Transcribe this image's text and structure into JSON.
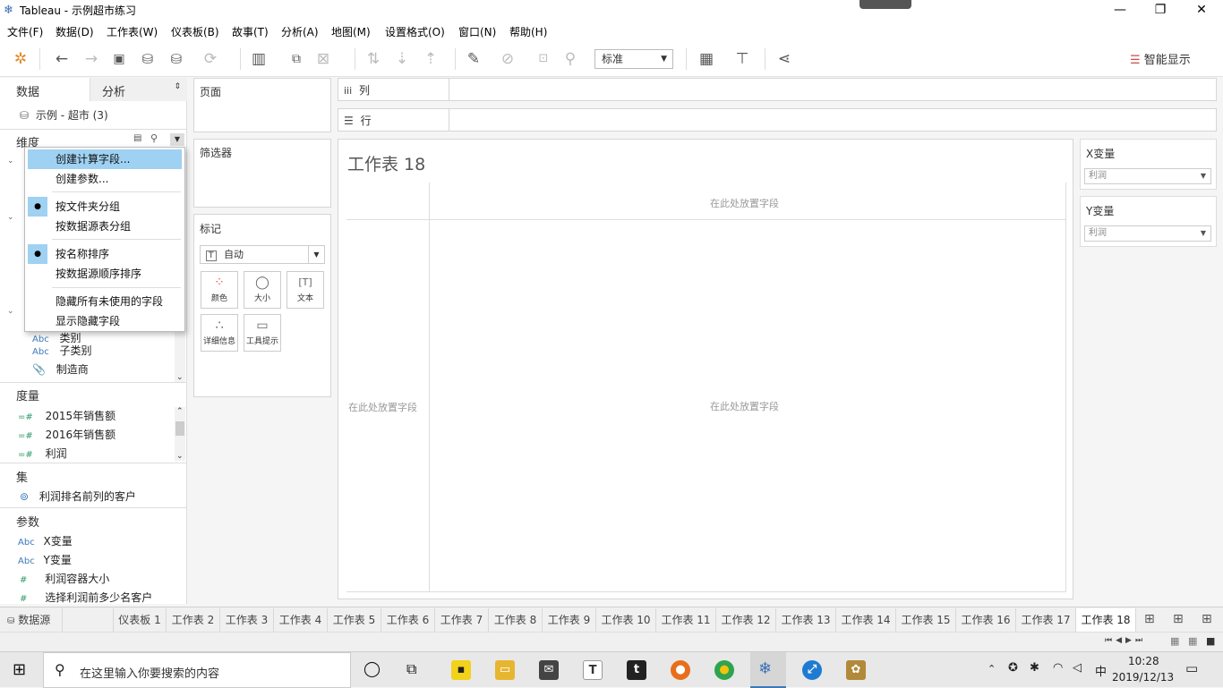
{
  "window": {
    "title": "Tableau - 示例超市练习",
    "min": "—",
    "restore": "❐",
    "close": "✕"
  },
  "menu": [
    "文件(F)",
    "数据(D)",
    "工作表(W)",
    "仪表板(B)",
    "故事(T)",
    "分析(A)",
    "地图(M)",
    "设置格式(O)",
    "窗口(N)",
    "帮助(H)"
  ],
  "toolbar": {
    "fit": "标准",
    "smart_show": "智能显示"
  },
  "leftpane": {
    "tab_data": "数据",
    "tab_analysis": "分析",
    "datasource": "示例 - 超市 (3)",
    "dimensions": "维度",
    "dim_items": [
      {
        "type": "Abc",
        "label": "类别"
      },
      {
        "type": "Abc",
        "label": "子类别"
      },
      {
        "type": "📎",
        "label": "制造商"
      }
    ],
    "measures": "度量",
    "measure_items": [
      {
        "type": "=#",
        "label": "2015年销售额"
      },
      {
        "type": "=#",
        "label": "2016年销售额"
      },
      {
        "type": "=#",
        "label": "利润"
      }
    ],
    "sets": "集",
    "set_items": [
      {
        "label": "利润排名前列的客户"
      }
    ],
    "params": "参数",
    "param_items": [
      {
        "type": "Abc",
        "label": "X变量"
      },
      {
        "type": "Abc",
        "label": "Y变量"
      },
      {
        "type": "#",
        "label": "利润容器大小"
      },
      {
        "type": "#",
        "label": "选择利润前多少名客户"
      }
    ]
  },
  "context_menu": {
    "items": [
      "创建计算字段...",
      "创建参数...",
      "按文件夹分组",
      "按数据源表分组",
      "按名称排序",
      "按数据源顺序排序",
      "隐藏所有未使用的字段",
      "显示隐藏字段"
    ],
    "checked_mark": "●"
  },
  "cards": {
    "pages": "页面",
    "filters": "筛选器",
    "marks": "标记",
    "mark_type": "自动",
    "color": "颜色",
    "size": "大小",
    "text": "文本",
    "detail": "详细信息",
    "tooltip": "工具提示"
  },
  "shelves": {
    "columns": "列",
    "rows": "行"
  },
  "canvas": {
    "title": "工作表 18",
    "drop_top": "在此处放置字段",
    "drop_left": "在此处放置字段",
    "drop_center": "在此处放置字段"
  },
  "params_panel": [
    {
      "title": "X变量",
      "value": "利润"
    },
    {
      "title": "Y变量",
      "value": "利润"
    }
  ],
  "sheets": [
    "数据源",
    "仪表板 1",
    "工作表 2",
    "工作表 3",
    "工作表 4",
    "工作表 5",
    "工作表 6",
    "工作表 7",
    "工作表 8",
    "工作表 9",
    "工作表 10",
    "工作表 11",
    "工作表 12",
    "工作表 13",
    "工作表 14",
    "工作表 15",
    "工作表 16",
    "工作表 17",
    "工作表 18"
  ],
  "taskbar": {
    "search": "在这里输入你要搜索的内容",
    "ime": "中",
    "time": "10:28",
    "date": "2019/12/13"
  },
  "colors": {
    "selection": "#9fd1f2",
    "tableau_blue": "#3d7ab8"
  }
}
